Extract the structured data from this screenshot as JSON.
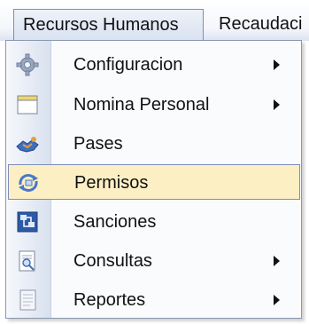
{
  "menubar": {
    "active_menu": "Recursos Humanos",
    "next_menu": "Recaudaci"
  },
  "dropdown": {
    "items": [
      {
        "label": "Configuracion",
        "icon": "gear-icon",
        "has_submenu": true
      },
      {
        "label": "Nomina Personal",
        "icon": "window-icon",
        "has_submenu": true
      },
      {
        "label": "Pases",
        "icon": "handshake-icon",
        "has_submenu": false
      },
      {
        "label": "Permisos",
        "icon": "permission-icon",
        "has_submenu": false,
        "highlighted": true
      },
      {
        "label": "Sanciones",
        "icon": "network-icon",
        "has_submenu": false
      },
      {
        "label": "Consultas",
        "icon": "search-doc-icon",
        "has_submenu": true
      },
      {
        "label": "Reportes",
        "icon": "report-icon",
        "has_submenu": true
      }
    ]
  },
  "colors": {
    "highlight": "#fdefc4",
    "highlight_border": "#7e8db8",
    "menu_border": "#8a97ad"
  }
}
